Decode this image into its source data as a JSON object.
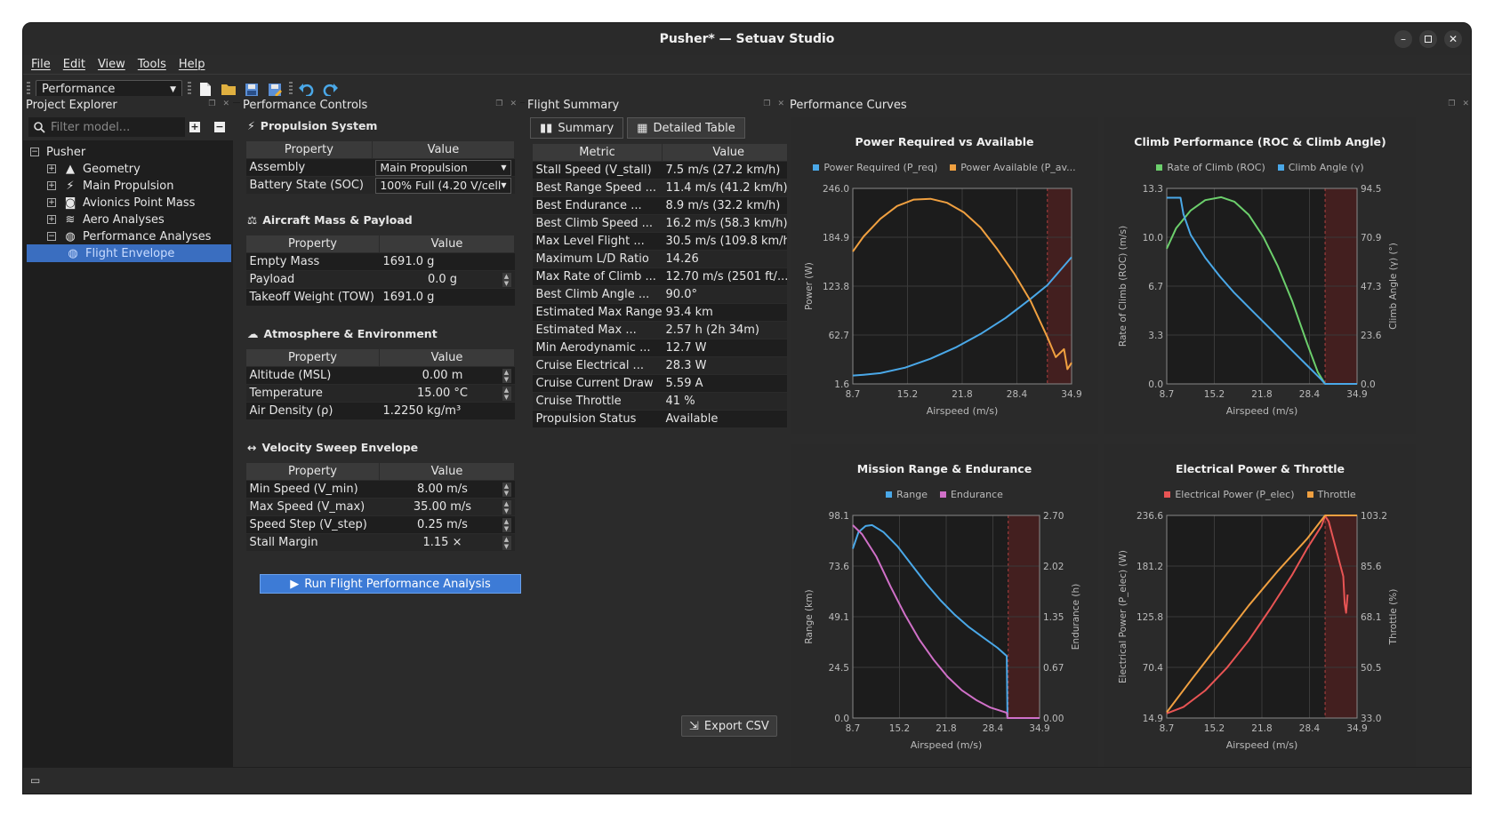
{
  "window": {
    "title": "Pusher* — Setuav Studio"
  },
  "menu": [
    "File",
    "Edit",
    "View",
    "Tools",
    "Help"
  ],
  "toolbar": {
    "workspace": "Performance"
  },
  "explorer": {
    "title": "Project Explorer",
    "filter_placeholder": "Filter model...",
    "root": "Pusher",
    "items": [
      "Geometry",
      "Main Propulsion",
      "Avionics Point Mass",
      "Aero Analyses",
      "Performance Analyses"
    ],
    "child": "Flight Envelope"
  },
  "controls": {
    "title": "Performance Controls",
    "prop_header": "Property",
    "value_header": "Value",
    "propulsion": {
      "heading": "Propulsion System",
      "rows": [
        {
          "p": "Assembly",
          "v": "Main Propulsion"
        },
        {
          "p": "Battery State (SOC)",
          "v": "100% Full (4.20 V/cell"
        }
      ]
    },
    "mass": {
      "heading": "Aircraft Mass & Payload",
      "rows": [
        {
          "p": "Empty Mass",
          "v": "1691.0 g"
        },
        {
          "p": "Payload",
          "v": "0.0 g"
        },
        {
          "p": "Takeoff Weight (TOW)",
          "v": "1691.0 g"
        }
      ]
    },
    "atmo": {
      "heading": "Atmosphere & Environment",
      "rows": [
        {
          "p": "Altitude (MSL)",
          "v": "0.00 m"
        },
        {
          "p": "Temperature",
          "v": "15.00 °C"
        },
        {
          "p": "Air Density (ρ)",
          "v": "1.2250 kg/m³"
        }
      ]
    },
    "sweep": {
      "heading": "Velocity Sweep Envelope",
      "rows": [
        {
          "p": "Min Speed (V_min)",
          "v": "8.00 m/s"
        },
        {
          "p": "Max Speed (V_max)",
          "v": "35.00 m/s"
        },
        {
          "p": "Speed Step (V_step)",
          "v": "0.25 m/s"
        },
        {
          "p": "Stall Margin",
          "v": "1.15 ×"
        }
      ]
    },
    "run_label": "Run Flight Performance Analysis"
  },
  "summary": {
    "title": "Flight Summary",
    "tab_summary": "Summary",
    "tab_table": "Detailed Table",
    "metric_header": "Metric",
    "value_header": "Value",
    "rows": [
      {
        "m": "Stall Speed (V_stall)",
        "v": "7.5 m/s (27.2 km/h)"
      },
      {
        "m": "Best Range Speed ...",
        "v": "11.4 m/s (41.2 km/h)"
      },
      {
        "m": "Best Endurance ...",
        "v": "8.9 m/s (32.2 km/h)"
      },
      {
        "m": "Best Climb Speed ...",
        "v": "16.2 m/s (58.3 km/h)"
      },
      {
        "m": "Max Level Flight ...",
        "v": "30.5 m/s (109.8 km/h)"
      },
      {
        "m": "Maximum L/D Ratio",
        "v": "14.26"
      },
      {
        "m": "Max Rate of Climb ...",
        "v": "12.70 m/s (2501 ft/..."
      },
      {
        "m": "Best Climb Angle ...",
        "v": "90.0°"
      },
      {
        "m": "Estimated Max Range",
        "v": "93.4 km"
      },
      {
        "m": "Estimated Max ...",
        "v": "2.57 h (2h 34m)"
      },
      {
        "m": "Min Aerodynamic ...",
        "v": "12.7 W"
      },
      {
        "m": "Cruise Electrical ...",
        "v": "28.3 W"
      },
      {
        "m": "Cruise Current Draw",
        "v": "5.59 A"
      },
      {
        "m": "Cruise Throttle",
        "v": "41 %"
      },
      {
        "m": "Propulsion Status",
        "v": "Available"
      }
    ],
    "export_label": "Export CSV"
  },
  "curves_title": "Performance Curves",
  "chart_data": [
    {
      "type": "line",
      "title": "Power Required vs Available",
      "xlabel": "Airspeed (m/s)",
      "ylabel": "Power (W)",
      "xlim": [
        8.7,
        34.9
      ],
      "ylim": [
        1.6,
        246.0
      ],
      "xticks": [
        "8.7",
        "15.2",
        "21.8",
        "28.4",
        "34.9"
      ],
      "yticks": [
        "1.6",
        "62.7",
        "123.8",
        "184.9",
        "246.0"
      ],
      "shade_from": 32.0,
      "series": [
        {
          "name": "Power Required (P_req)",
          "color": "#4aa8e8",
          "x": [
            8.7,
            10,
            12,
            15,
            18,
            21,
            24,
            27,
            30,
            32,
            34.9
          ],
          "y": [
            12,
            13,
            15,
            22,
            33,
            47,
            64,
            84,
            108,
            125,
            160
          ]
        },
        {
          "name": "Power Available (P_av...",
          "color": "#f0a040",
          "x": [
            8.7,
            10,
            12,
            14,
            16,
            18,
            20,
            22,
            24,
            26,
            28,
            30,
            32,
            33,
            34,
            34.4,
            34.9
          ],
          "y": [
            167,
            186,
            208,
            224,
            232,
            233,
            228,
            216,
            197,
            170,
            140,
            105,
            60,
            35,
            45,
            20,
            28
          ]
        }
      ]
    },
    {
      "type": "line",
      "title": "Climb Performance (ROC & Climb Angle)",
      "xlabel": "Airspeed (m/s)",
      "ylabel": "Rate of Climb (ROC) (m/s)",
      "y2label": "Climb Angle (γ) (°)",
      "xlim": [
        8.7,
        34.9
      ],
      "ylim": [
        0.0,
        13.3
      ],
      "y2lim": [
        0.0,
        94.5
      ],
      "xticks": [
        "8.7",
        "15.2",
        "21.8",
        "28.4",
        "34.9"
      ],
      "yticks": [
        "0.0",
        "3.3",
        "6.7",
        "10.0",
        "13.3"
      ],
      "y2ticks": [
        "0.0",
        "23.6",
        "47.3",
        "70.9",
        "94.5"
      ],
      "shade_from": 30.5,
      "series": [
        {
          "name": "Rate of Climb (ROC)",
          "color": "#6ccf6c",
          "axis": "y",
          "x": [
            8.7,
            10,
            12,
            14,
            16.2,
            18,
            20,
            22,
            24,
            26,
            28,
            29.5,
            30.5,
            34.9
          ],
          "y": [
            9.2,
            10.6,
            11.8,
            12.5,
            12.7,
            12.4,
            11.5,
            10.0,
            8.0,
            5.6,
            2.8,
            0.8,
            0.0,
            0.0
          ]
        },
        {
          "name": "Climb Angle (γ)",
          "color": "#4aa8e8",
          "axis": "y2",
          "x": [
            8.7,
            10.6,
            11,
            12,
            14,
            16,
            18,
            20,
            22,
            24,
            26,
            28,
            30,
            30.5,
            34.9
          ],
          "y": [
            90,
            90,
            82,
            72,
            61,
            52,
            44,
            37,
            30,
            23,
            16,
            9,
            2,
            0,
            0
          ]
        }
      ]
    },
    {
      "type": "line",
      "title": "Mission Range & Endurance",
      "xlabel": "Airspeed (m/s)",
      "ylabel": "Range (km)",
      "y2label": "Endurance (h)",
      "xlim": [
        8.7,
        34.9
      ],
      "ylim": [
        0.0,
        98.1
      ],
      "y2lim": [
        0.0,
        2.7
      ],
      "xticks": [
        "8.7",
        "15.2",
        "21.8",
        "28.4",
        "34.9"
      ],
      "yticks": [
        "0.0",
        "24.5",
        "49.1",
        "73.6",
        "98.1"
      ],
      "y2ticks": [
        "0.00",
        "0.67",
        "1.35",
        "2.02",
        "2.70"
      ],
      "shade_from": 30.5,
      "series": [
        {
          "name": "Range",
          "color": "#4aa8e8",
          "axis": "y",
          "x": [
            8.7,
            9.5,
            10.5,
            11.4,
            13,
            15,
            17,
            19,
            21,
            23,
            25,
            27,
            29,
            30.3,
            30.4,
            34.9
          ],
          "y": [
            82,
            90,
            93,
            93.4,
            90,
            83,
            74,
            65,
            57,
            50,
            44,
            39,
            34,
            30,
            0,
            0
          ]
        },
        {
          "name": "Endurance",
          "color": "#d070c8",
          "axis": "y2",
          "x": [
            8.7,
            10,
            12,
            14,
            16,
            18,
            20,
            22,
            24,
            26,
            28,
            30.3,
            30.4,
            34.9
          ],
          "y": [
            2.57,
            2.45,
            2.15,
            1.75,
            1.38,
            1.05,
            0.78,
            0.55,
            0.37,
            0.24,
            0.14,
            0.07,
            0,
            0
          ]
        }
      ]
    },
    {
      "type": "line",
      "title": "Electrical Power & Throttle",
      "xlabel": "Airspeed (m/s)",
      "ylabel": "Electrical Power (P_elec) (W)",
      "y2label": "Throttle (%)",
      "xlim": [
        8.7,
        34.9
      ],
      "ylim": [
        14.9,
        236.6
      ],
      "y2lim": [
        33.0,
        103.2
      ],
      "xticks": [
        "8.7",
        "15.2",
        "21.8",
        "28.4",
        "34.9"
      ],
      "yticks": [
        "14.9",
        "70.4",
        "125.8",
        "181.2",
        "236.6"
      ],
      "y2ticks": [
        "33.0",
        "50.5",
        "68.1",
        "85.6",
        "103.2"
      ],
      "shade_from": 30.5,
      "series": [
        {
          "name": "Electrical Power (P_elec)",
          "color": "#e85454",
          "axis": "y",
          "x": [
            8.7,
            11,
            14,
            17,
            20,
            23,
            26,
            28,
            30,
            30.5,
            31,
            31.5,
            32,
            32.5,
            33,
            33.2,
            33.4,
            33.6
          ],
          "y": [
            20,
            27,
            45,
            70,
            100,
            135,
            172,
            200,
            225,
            236,
            230,
            215,
            200,
            185,
            170,
            140,
            130,
            150
          ]
        },
        {
          "name": "Throttle",
          "color": "#f0a040",
          "axis": "y2",
          "x": [
            8.7,
            12,
            16,
            20,
            24,
            28,
            30.5,
            34.9
          ],
          "y": [
            35,
            46,
            59,
            72,
            84,
            95,
            103.2,
            103.2
          ]
        }
      ]
    }
  ]
}
